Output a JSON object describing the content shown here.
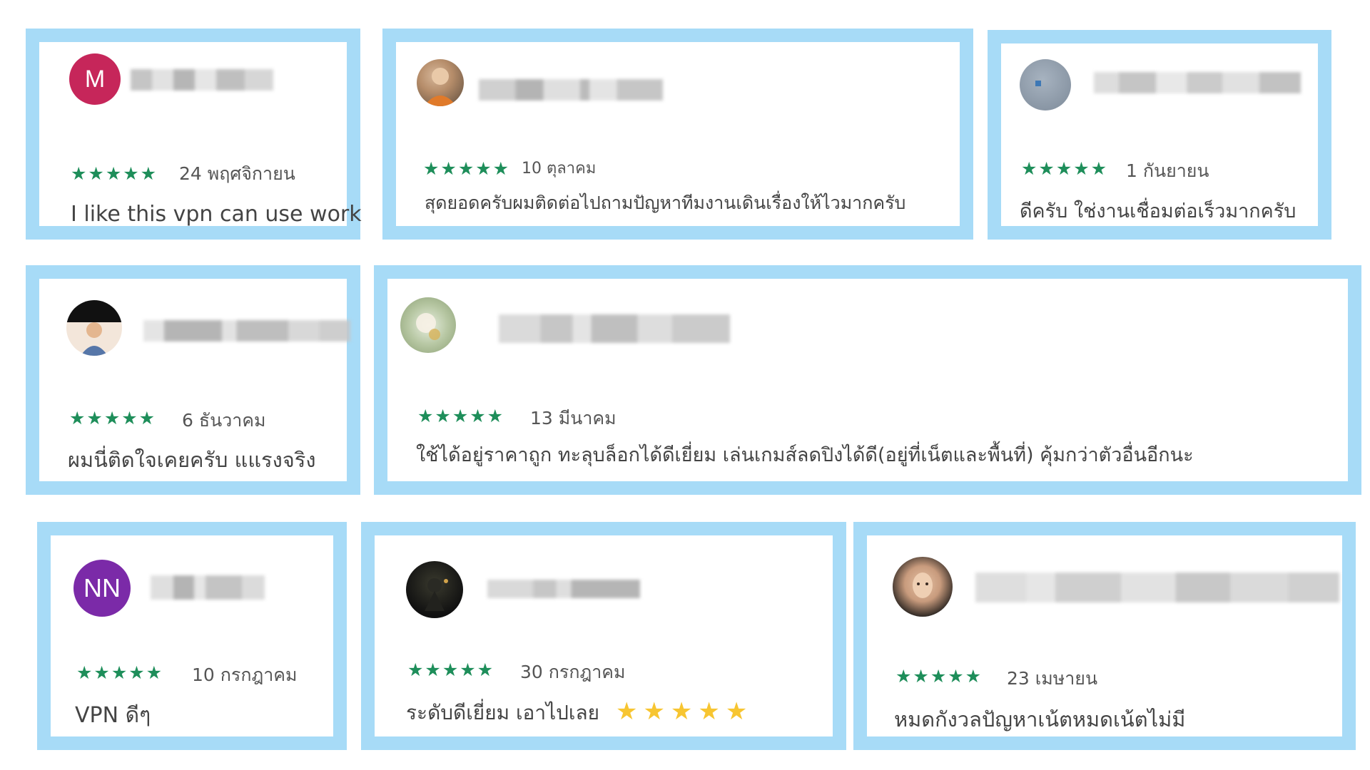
{
  "reviews": [
    {
      "avatar_letter": "M",
      "avatar_color": "#c6265a",
      "stars": "★★★★★",
      "date": "24 พฤศจิกายน",
      "text": "I like this vpn can use work"
    },
    {
      "avatar_letter": "",
      "stars": "★★★★★",
      "date": "10 ตุลาคม",
      "text": "สุดยอดครับผมติดต่อไปถามปัญหาทีมงานเดินเรื่องให้ไวมากครับ"
    },
    {
      "avatar_letter": "",
      "stars": "★★★★★",
      "date": "1 กันยายน",
      "text": "ดีครับ ใช่งานเชื่อมต่อเร็วมากครับ"
    },
    {
      "avatar_letter": "",
      "stars": "★★★★★",
      "date": "6 ธันวาคม",
      "text": "ผมนี่ติดใจเคยครับ แแรงจริง"
    },
    {
      "avatar_letter": "",
      "stars": "★★★★★",
      "date": "13 มีนาคม",
      "text": "ใช้ได้อยู่ราคาถูก ทะลุบล็อกได้ดีเยี่ยม เล่นเกมส์ลดปิงได้ดี(อยู่ที่เน็ตและพื้นที่) คุ้มกว่าตัวอื่นอีกนะ"
    },
    {
      "avatar_letter": "NN",
      "avatar_color": "#7b2aa8",
      "stars": "★★★★★",
      "date": "10 กรกฎาคม",
      "text": "VPN ดีๆ"
    },
    {
      "avatar_letter": "",
      "stars": "★★★★★",
      "date": "30 กรกฎาคม",
      "text": "ระดับดีเยี่ยม เอาไปเลย",
      "emoji_stars": "★★★★★"
    },
    {
      "avatar_letter": "",
      "stars": "★★★★★",
      "date": "23 เมษายน",
      "text": "หมดกังวลปัญหาเน้ตหมดเน้ตไม่มี"
    }
  ]
}
